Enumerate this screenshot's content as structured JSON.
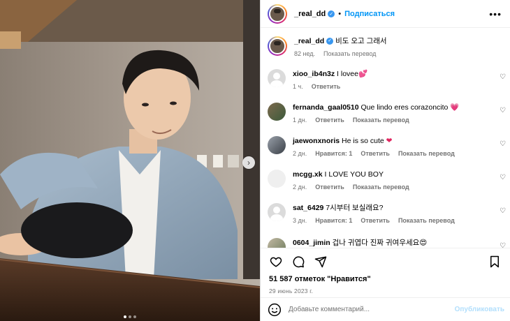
{
  "post": {
    "username": "_real_dd",
    "follow_label": "Подписаться",
    "separator": "•",
    "more_label": "•••",
    "caption_user": "_real_dd",
    "caption_text": "비도 오고 그래서",
    "caption_age": "82 нед.",
    "caption_translate": "Показать перевод"
  },
  "comments": [
    {
      "user": "xioo_ib4n3z",
      "text": "I lovee",
      "emoji": "💕",
      "time": "1 ч.",
      "likes": "",
      "reply": "Ответить",
      "translate": ""
    },
    {
      "user": "fernanda_gaal0510",
      "text": "Que lindo eres corazoncito",
      "emoji": "💗",
      "time": "1 дн.",
      "likes": "",
      "reply": "Ответить",
      "translate": "Показать перевод"
    },
    {
      "user": "jaewonxnoris",
      "text": "He is so cute",
      "emoji": "❤",
      "time": "2 дн.",
      "likes": "Нравится: 1",
      "reply": "Ответить",
      "translate": "Показать перевод"
    },
    {
      "user": "mcgg.xk",
      "text": "I LOVE YOU BOY",
      "emoji": "",
      "time": "2 дн.",
      "likes": "",
      "reply": "Ответить",
      "translate": "Показать перевод"
    },
    {
      "user": "sat_6429",
      "text": "7시부터 보실래요?",
      "emoji": "",
      "time": "3 дн.",
      "likes": "Нравится: 1",
      "reply": "Ответить",
      "translate": "Показать перевод"
    },
    {
      "user": "0604_jimin",
      "text": "겁나 귀엽다 진짜 귀여우세요",
      "emoji": "😍",
      "time": "",
      "likes": "",
      "reply": "",
      "translate": ""
    }
  ],
  "stats": {
    "likes": "51 587 отметок \"Нравится\"",
    "date": "29 июнь 2023 г."
  },
  "comment_box": {
    "placeholder": "Добавьте комментарий...",
    "publish": "Опубликовать"
  },
  "icons": {
    "like": "heart-icon",
    "comment": "comment-icon",
    "share": "share-icon",
    "save": "bookmark-icon",
    "next": "chevron-right-icon"
  },
  "carousel": {
    "count": 3,
    "active": 1
  },
  "colors": {
    "accent": "#0095f6",
    "verified": "#3897f0",
    "muted": "#737373",
    "publish_disabled": "#b2dffc"
  }
}
